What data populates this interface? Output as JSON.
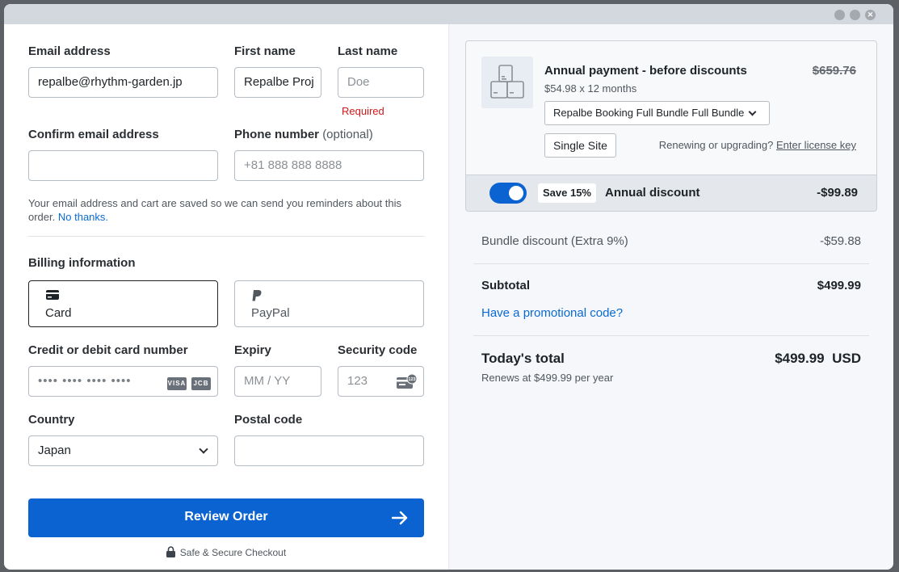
{
  "form": {
    "email_label": "Email address",
    "email_value": "repalbe@rhythm-garden.jp",
    "first_name_label": "First name",
    "first_name_value": "Repalbe Proj",
    "last_name_label": "Last name",
    "last_name_placeholder": "Doe",
    "last_name_error": "Required",
    "confirm_email_label": "Confirm email address",
    "confirm_email_value": "",
    "phone_label": "Phone number",
    "phone_optional": "(optional)",
    "phone_placeholder": "+81 888 888 8888",
    "reminder_note": "Your email address and cart are saved so we can send you reminders about this order.",
    "reminder_link": "No thanks."
  },
  "billing": {
    "title": "Billing information",
    "methods": [
      {
        "label": "Card",
        "icon": "credit-card-icon",
        "selected": true
      },
      {
        "label": "PayPal",
        "icon": "paypal-icon",
        "selected": false
      }
    ],
    "card_label": "Credit or debit card number",
    "card_placeholder": "•••• •••• •••• ••••",
    "card_brands": [
      "VISA",
      "JCB"
    ],
    "expiry_label": "Expiry",
    "expiry_placeholder": "MM / YY",
    "security_label": "Security code",
    "security_placeholder": "123",
    "country_label": "Country",
    "country_value": "Japan",
    "postal_label": "Postal code",
    "postal_value": ""
  },
  "cta": {
    "label": "Review Order",
    "secure_text": "Safe & Secure Checkout"
  },
  "summary": {
    "product_title": "Annual payment - before discounts",
    "original_price": "$659.76",
    "price_breakdown": "$54.98 x 12 months",
    "bundle_select": "Repalbe Booking Full Bundle Full Bundle",
    "license_type": "Single Site",
    "renew_text": "Renewing or upgrading?",
    "renew_link": "Enter license key",
    "annual_discount": {
      "enabled": true,
      "badge": "Save 15%",
      "label": "Annual discount",
      "amount": "-$99.89"
    },
    "bundle_discount_label": "Bundle discount (Extra 9%)",
    "bundle_discount_amount": "-$59.88",
    "subtotal_label": "Subtotal",
    "subtotal_amount": "$499.99",
    "promo_link": "Have a promotional code?",
    "total_label": "Today's total",
    "total_amount": "$499.99",
    "currency": "USD",
    "renews_text": "Renews at $499.99 per year"
  },
  "colors": {
    "accent": "#0a63d1",
    "link": "#0a6ad1",
    "error": "#cc1818"
  }
}
